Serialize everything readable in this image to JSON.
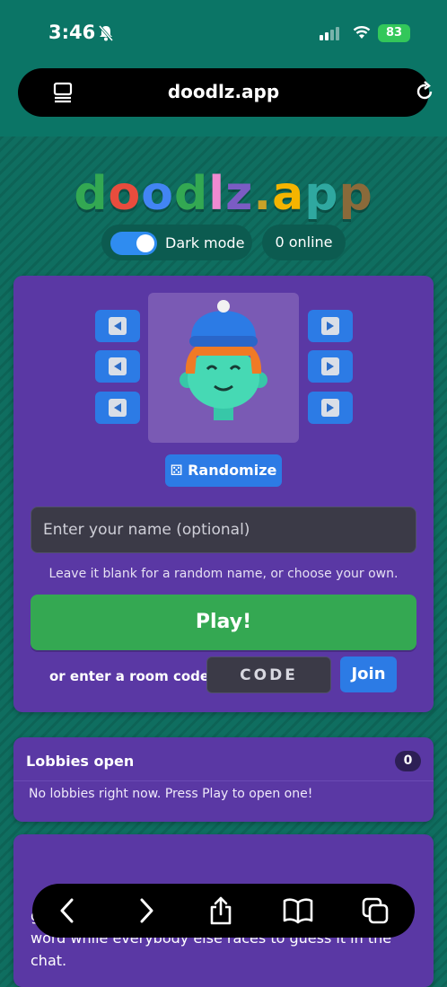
{
  "status_bar": {
    "time": "3:46",
    "battery": "83"
  },
  "browser": {
    "url": "doodlz.app"
  },
  "logo": {
    "letters": [
      {
        "ch": "d",
        "color": "#33a852"
      },
      {
        "ch": "o",
        "color": "#e84c3d"
      },
      {
        "ch": "o",
        "color": "#4285f4"
      },
      {
        "ch": "d",
        "color": "#33a852"
      },
      {
        "ch": "l",
        "color": "#f08ad1"
      },
      {
        "ch": "z",
        "color": "#7b5cc4"
      },
      {
        "ch": ".",
        "color": "#c9a227"
      },
      {
        "ch": "a",
        "color": "#f4b400"
      },
      {
        "ch": "p",
        "color": "#2fa8a0"
      },
      {
        "ch": "p",
        "color": "#8a6a3a"
      }
    ]
  },
  "dark_mode": {
    "label": "Dark mode",
    "on": true
  },
  "online": {
    "label": "0 online"
  },
  "avatar": {
    "randomize_label": "⚄ Randomize"
  },
  "name_field": {
    "placeholder": "Enter your name (optional)",
    "value": ""
  },
  "hint": "Leave it blank for a random name, or choose your own.",
  "play_label": "Play!",
  "room": {
    "label": "or enter a room code",
    "placeholder": "CODE",
    "join_label": "Join"
  },
  "lobbies": {
    "title": "Lobbies open",
    "count": "0",
    "empty_text": "No lobbies right now. Press Play to open one!"
  },
  "about": {
    "text": "guessing game. Each turn one player draws a secret word while everybody else races to guess it in the chat."
  }
}
